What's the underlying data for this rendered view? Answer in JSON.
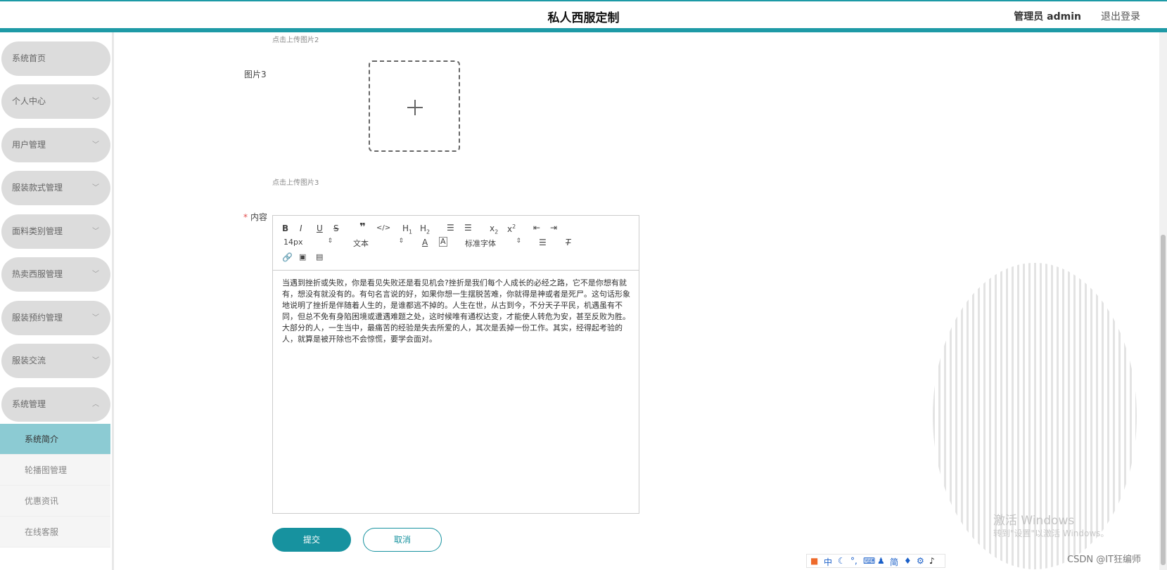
{
  "header": {
    "title": "私人西服定制",
    "admin": "管理员 admin",
    "logout": "退出登录"
  },
  "sidebar": {
    "items": [
      {
        "label": "系统首页"
      },
      {
        "label": "个人中心"
      },
      {
        "label": "用户管理"
      },
      {
        "label": "服装款式管理"
      },
      {
        "label": "面料类别管理"
      },
      {
        "label": "热卖西服管理"
      },
      {
        "label": "服装预约管理"
      },
      {
        "label": "服装交流"
      },
      {
        "label": "系统管理"
      }
    ],
    "subitems": [
      {
        "label": "系统简介",
        "active": true
      },
      {
        "label": "轮播图管理"
      },
      {
        "label": "优惠资讯"
      },
      {
        "label": "在线客服"
      }
    ]
  },
  "form": {
    "hint2": "点击上传图片2",
    "image3_label": "图片3",
    "hint3": "点击上传图片3",
    "content_label": "内容",
    "submit_label": "提交",
    "cancel_label": "取消"
  },
  "editor": {
    "font_size": "14px",
    "format": "文本",
    "font_family": "标准字体",
    "content": "当遇到挫折或失败，你是看见失败还是看见机会?挫折是我们每个人成长的必经之路，它不是你想有就有，想没有就没有的。有句名言说的好，如果你想一生摆脱苦难，你就得是神或者是死尸。这句话形象地说明了挫折是伴随着人生的，是谁都逃不掉的。人生在世，从古到今，不分天子平民，机遇虽有不同，但总不免有身陷困境或遭遇难题之处，这时候唯有通权达变，才能使人转危为安，甚至反败为胜。大部分的人，一生当中，最痛苦的经验是失去所爱的人，其次是丢掉一份工作。其实，经得起考验的人，就算是被开除也不会惊慌，要学会面对。"
  },
  "overlay": {
    "watermark_title": "激活 Windows",
    "watermark_sub": "转到\"设置\"以激活 Windows。",
    "csdn": "CSDN @IT狂编师",
    "ime_zh": "中",
    "ime_simplified": "简"
  }
}
